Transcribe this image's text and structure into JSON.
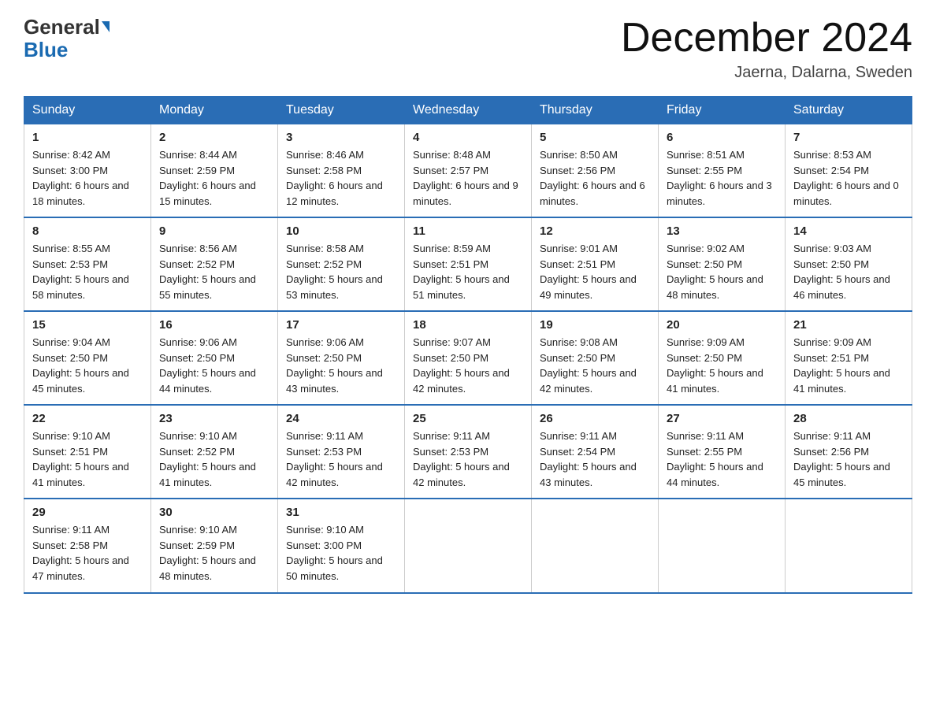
{
  "header": {
    "logo_line1": "General",
    "logo_line2": "Blue",
    "month_title": "December 2024",
    "location": "Jaerna, Dalarna, Sweden"
  },
  "days_of_week": [
    "Sunday",
    "Monday",
    "Tuesday",
    "Wednesday",
    "Thursday",
    "Friday",
    "Saturday"
  ],
  "weeks": [
    [
      {
        "day": "1",
        "sunrise": "8:42 AM",
        "sunset": "3:00 PM",
        "daylight": "6 hours and 18 minutes."
      },
      {
        "day": "2",
        "sunrise": "8:44 AM",
        "sunset": "2:59 PM",
        "daylight": "6 hours and 15 minutes."
      },
      {
        "day": "3",
        "sunrise": "8:46 AM",
        "sunset": "2:58 PM",
        "daylight": "6 hours and 12 minutes."
      },
      {
        "day": "4",
        "sunrise": "8:48 AM",
        "sunset": "2:57 PM",
        "daylight": "6 hours and 9 minutes."
      },
      {
        "day": "5",
        "sunrise": "8:50 AM",
        "sunset": "2:56 PM",
        "daylight": "6 hours and 6 minutes."
      },
      {
        "day": "6",
        "sunrise": "8:51 AM",
        "sunset": "2:55 PM",
        "daylight": "6 hours and 3 minutes."
      },
      {
        "day": "7",
        "sunrise": "8:53 AM",
        "sunset": "2:54 PM",
        "daylight": "6 hours and 0 minutes."
      }
    ],
    [
      {
        "day": "8",
        "sunrise": "8:55 AM",
        "sunset": "2:53 PM",
        "daylight": "5 hours and 58 minutes."
      },
      {
        "day": "9",
        "sunrise": "8:56 AM",
        "sunset": "2:52 PM",
        "daylight": "5 hours and 55 minutes."
      },
      {
        "day": "10",
        "sunrise": "8:58 AM",
        "sunset": "2:52 PM",
        "daylight": "5 hours and 53 minutes."
      },
      {
        "day": "11",
        "sunrise": "8:59 AM",
        "sunset": "2:51 PM",
        "daylight": "5 hours and 51 minutes."
      },
      {
        "day": "12",
        "sunrise": "9:01 AM",
        "sunset": "2:51 PM",
        "daylight": "5 hours and 49 minutes."
      },
      {
        "day": "13",
        "sunrise": "9:02 AM",
        "sunset": "2:50 PM",
        "daylight": "5 hours and 48 minutes."
      },
      {
        "day": "14",
        "sunrise": "9:03 AM",
        "sunset": "2:50 PM",
        "daylight": "5 hours and 46 minutes."
      }
    ],
    [
      {
        "day": "15",
        "sunrise": "9:04 AM",
        "sunset": "2:50 PM",
        "daylight": "5 hours and 45 minutes."
      },
      {
        "day": "16",
        "sunrise": "9:06 AM",
        "sunset": "2:50 PM",
        "daylight": "5 hours and 44 minutes."
      },
      {
        "day": "17",
        "sunrise": "9:06 AM",
        "sunset": "2:50 PM",
        "daylight": "5 hours and 43 minutes."
      },
      {
        "day": "18",
        "sunrise": "9:07 AM",
        "sunset": "2:50 PM",
        "daylight": "5 hours and 42 minutes."
      },
      {
        "day": "19",
        "sunrise": "9:08 AM",
        "sunset": "2:50 PM",
        "daylight": "5 hours and 42 minutes."
      },
      {
        "day": "20",
        "sunrise": "9:09 AM",
        "sunset": "2:50 PM",
        "daylight": "5 hours and 41 minutes."
      },
      {
        "day": "21",
        "sunrise": "9:09 AM",
        "sunset": "2:51 PM",
        "daylight": "5 hours and 41 minutes."
      }
    ],
    [
      {
        "day": "22",
        "sunrise": "9:10 AM",
        "sunset": "2:51 PM",
        "daylight": "5 hours and 41 minutes."
      },
      {
        "day": "23",
        "sunrise": "9:10 AM",
        "sunset": "2:52 PM",
        "daylight": "5 hours and 41 minutes."
      },
      {
        "day": "24",
        "sunrise": "9:11 AM",
        "sunset": "2:53 PM",
        "daylight": "5 hours and 42 minutes."
      },
      {
        "day": "25",
        "sunrise": "9:11 AM",
        "sunset": "2:53 PM",
        "daylight": "5 hours and 42 minutes."
      },
      {
        "day": "26",
        "sunrise": "9:11 AM",
        "sunset": "2:54 PM",
        "daylight": "5 hours and 43 minutes."
      },
      {
        "day": "27",
        "sunrise": "9:11 AM",
        "sunset": "2:55 PM",
        "daylight": "5 hours and 44 minutes."
      },
      {
        "day": "28",
        "sunrise": "9:11 AM",
        "sunset": "2:56 PM",
        "daylight": "5 hours and 45 minutes."
      }
    ],
    [
      {
        "day": "29",
        "sunrise": "9:11 AM",
        "sunset": "2:58 PM",
        "daylight": "5 hours and 47 minutes."
      },
      {
        "day": "30",
        "sunrise": "9:10 AM",
        "sunset": "2:59 PM",
        "daylight": "5 hours and 48 minutes."
      },
      {
        "day": "31",
        "sunrise": "9:10 AM",
        "sunset": "3:00 PM",
        "daylight": "5 hours and 50 minutes."
      },
      null,
      null,
      null,
      null
    ]
  ]
}
